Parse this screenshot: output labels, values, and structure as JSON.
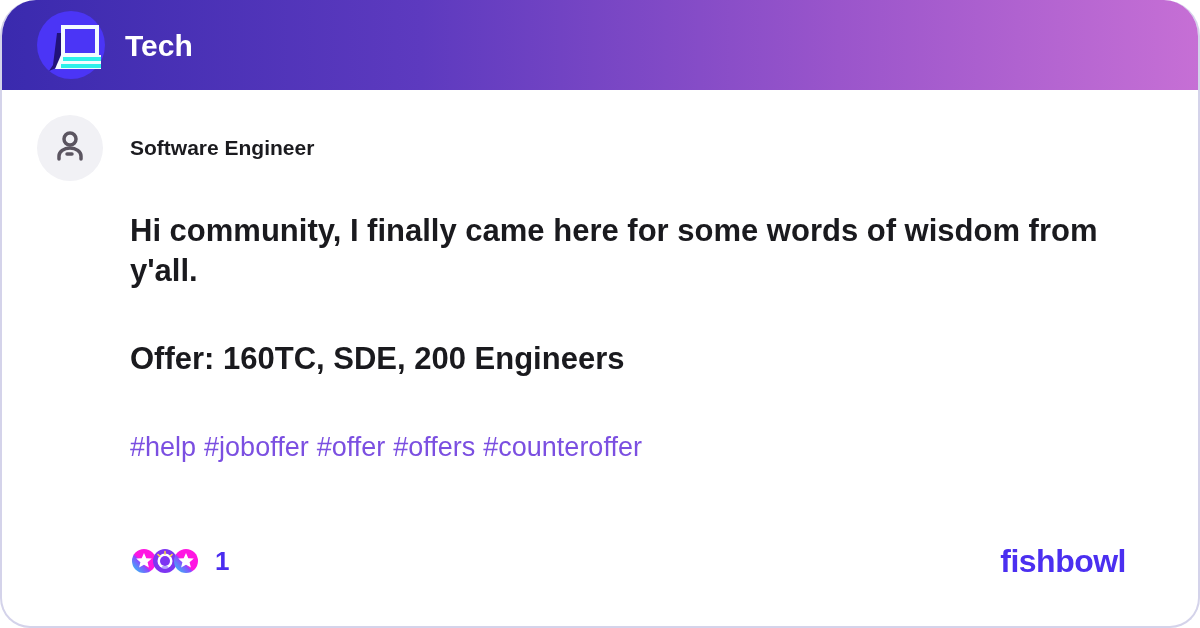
{
  "header": {
    "title": "Tech"
  },
  "post": {
    "author": "Software Engineer",
    "body": [
      "Hi community, I finally came here for some words of wisdom from y'all.",
      "Offer: 160TC, SDE, 200 Engineers"
    ],
    "tags": [
      "#help",
      "#joboffer",
      "#offer",
      "#offers",
      "#counteroffer"
    ]
  },
  "footer": {
    "reactions": [
      {
        "kind": "star"
      },
      {
        "kind": "bulb"
      },
      {
        "kind": "star"
      }
    ],
    "reaction_count": "1",
    "brand": "fishbowl"
  }
}
